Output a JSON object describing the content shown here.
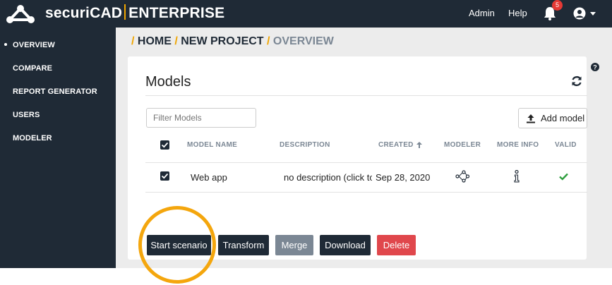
{
  "app": {
    "brand_name": "securiCAD",
    "brand_edition": "ENTERPRISE",
    "logo_icon": "securicad-logo-icon"
  },
  "topnav": {
    "admin_label": "Admin",
    "help_label": "Help",
    "notifications_count": "5",
    "bell_icon": "bell-icon",
    "user_icon": "user-circle-icon"
  },
  "sidebar": {
    "items": [
      {
        "label": "OVERVIEW",
        "active": true
      },
      {
        "label": "COMPARE"
      },
      {
        "label": "REPORT GENERATOR"
      },
      {
        "label": "USERS"
      },
      {
        "label": "MODELER"
      }
    ]
  },
  "breadcrumb": {
    "home": "HOME",
    "project": "NEW PROJECT",
    "current": "OVERVIEW"
  },
  "models_panel": {
    "title": "Models",
    "filter_placeholder": "Filter Models",
    "add_model_label": "Add model",
    "columns": [
      "MODEL NAME",
      "DESCRIPTION",
      "CREATED",
      "MODELER",
      "MORE INFO",
      "VALID"
    ],
    "rows": [
      {
        "checked": true,
        "name": "Web app",
        "description": "no description (click to edit)",
        "created": "Sep 28, 2020",
        "modeler_icon": "graph-nodes-icon",
        "info_icon": "info-icon",
        "valid_icon": "checkmark-icon"
      }
    ],
    "actions": {
      "start_scenario": "Start scenario",
      "transform": "Transform",
      "merge": "Merge",
      "download": "Download",
      "delete": "Delete"
    }
  },
  "colors": {
    "nav_bg": "#1f2a36",
    "accent": "#f0a500",
    "danger": "#e0474c",
    "muted": "#7b8794",
    "valid_green": "#2e9e3e",
    "highlight": "#f4a60d"
  }
}
